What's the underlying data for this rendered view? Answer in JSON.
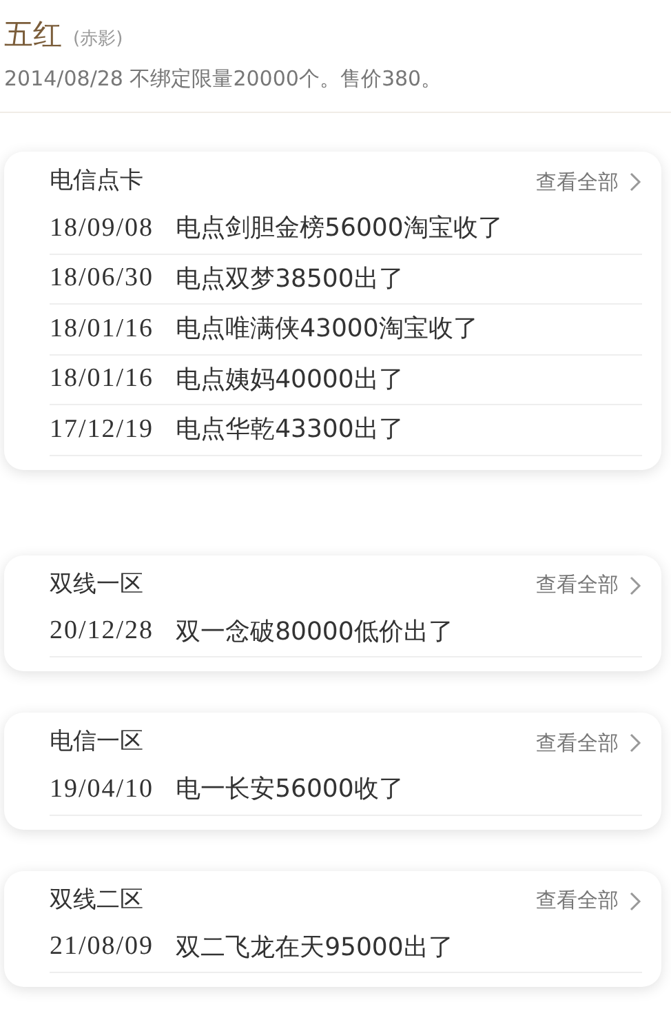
{
  "header": {
    "title": "五红",
    "tag": "(赤影)",
    "info": "2014/08/28 不绑定限量20000个。售价380。"
  },
  "sections": [
    {
      "title": "电信点卡",
      "view_all": "查看全部",
      "entries": [
        {
          "date": "18/09/08",
          "text": "电点剑胆金榜56000淘宝收了"
        },
        {
          "date": "18/06/30",
          "text": "电点双梦38500出了"
        },
        {
          "date": "18/01/16",
          "text": "电点唯满侠43000淘宝收了"
        },
        {
          "date": "18/01/16",
          "text": "电点姨妈40000出了"
        },
        {
          "date": "17/12/19",
          "text": "电点华乾43300出了"
        }
      ]
    },
    {
      "title": "双线一区",
      "view_all": "查看全部",
      "entries": [
        {
          "date": "20/12/28",
          "text": "双一念破80000低价出了"
        }
      ]
    },
    {
      "title": "电信一区",
      "view_all": "查看全部",
      "entries": [
        {
          "date": "19/04/10",
          "text": "电一长安56000收了"
        }
      ]
    },
    {
      "title": "双线二区",
      "view_all": "查看全部",
      "entries": [
        {
          "date": "21/08/09",
          "text": "双二飞龙在天95000出了"
        }
      ]
    }
  ]
}
